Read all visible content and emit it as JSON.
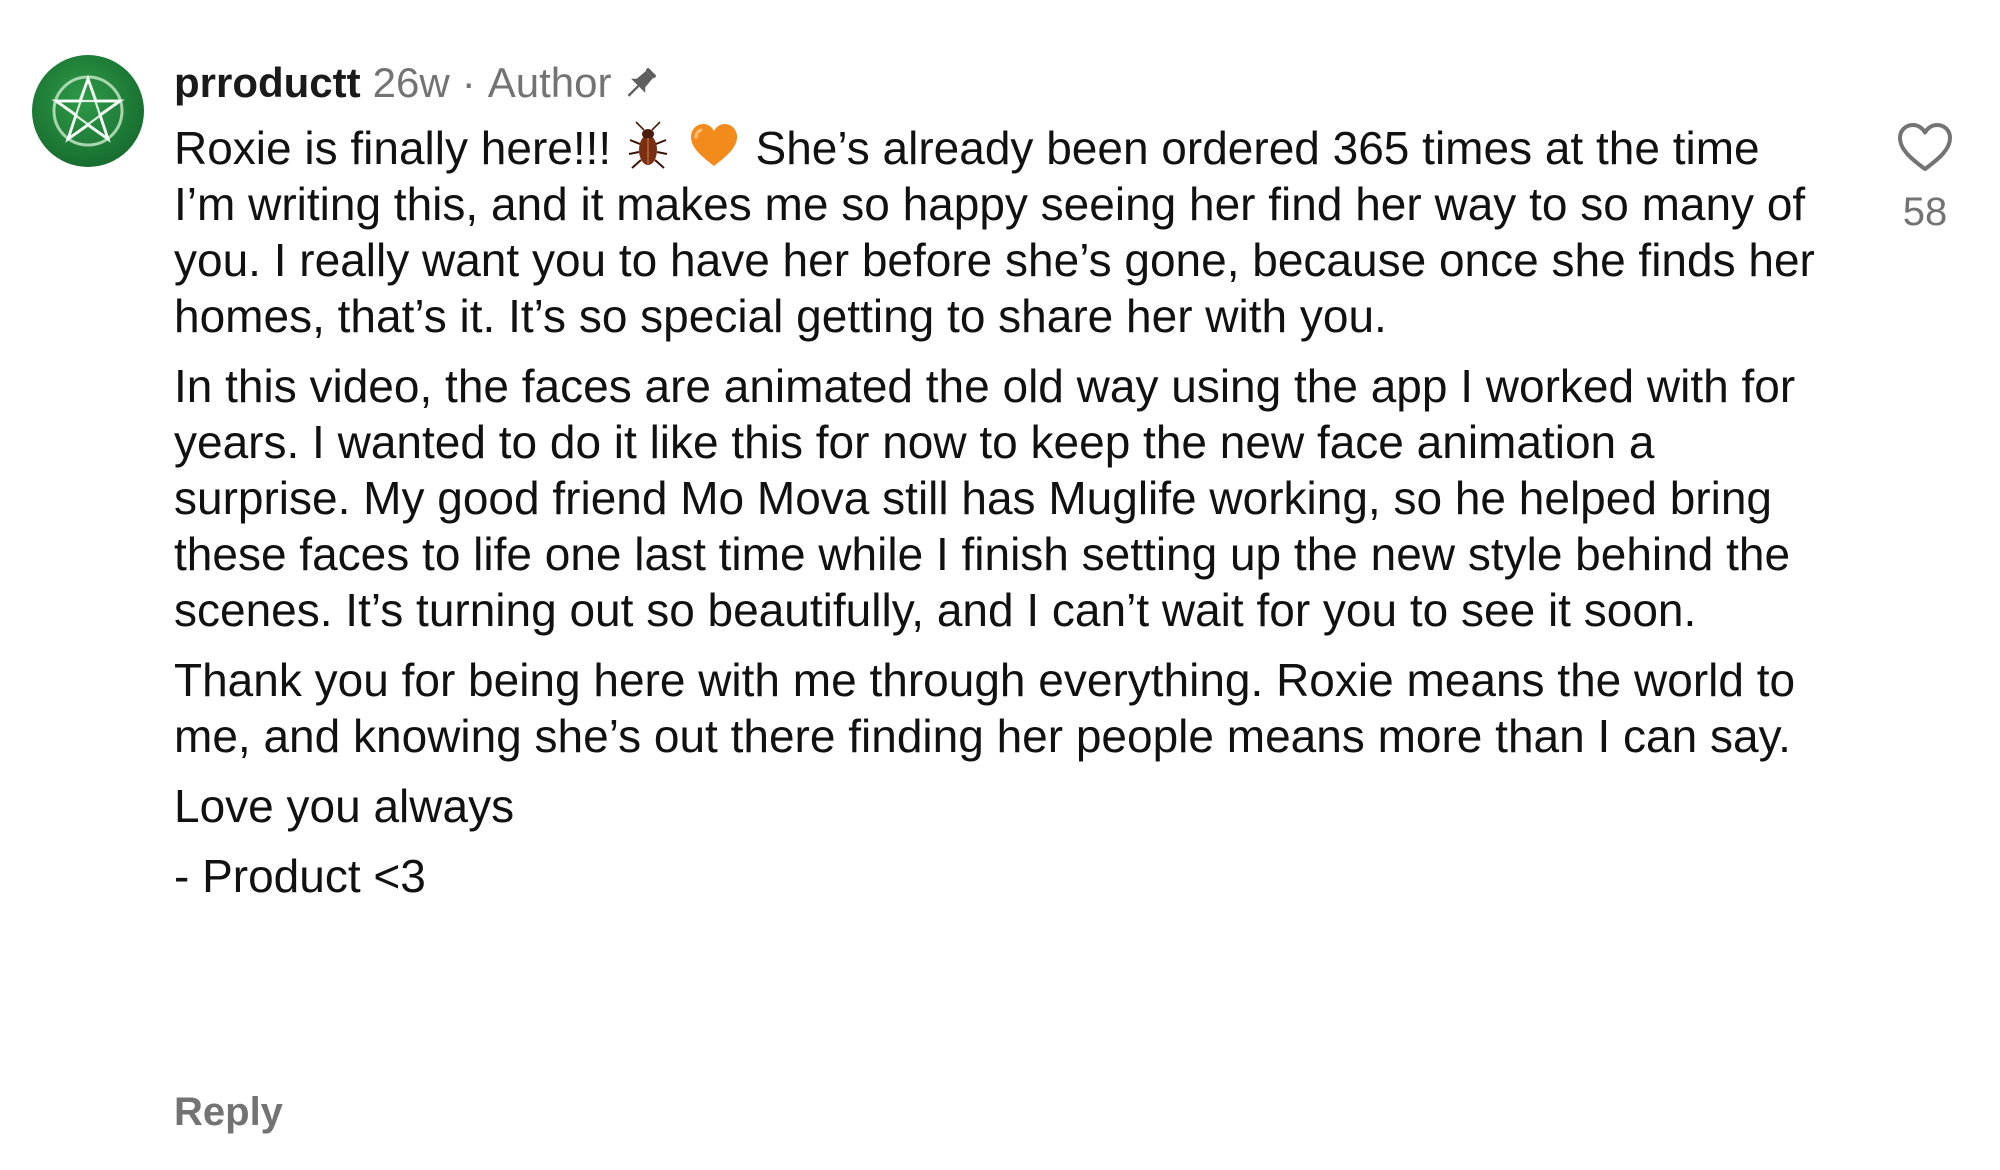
{
  "comment": {
    "username": "prroductt",
    "age": "26w",
    "separator": "·",
    "author_label": "Author",
    "paragraph1_part1": "Roxie is finally here!!!",
    "paragraph1_part2": "She’s already been ordered 365 times at the time I’m writing this, and it makes me so happy seeing her find her way to so many of you. I really want you to have her before she’s gone, because once she finds her homes, that’s it. It’s so special getting to share her with you.",
    "paragraph2": "In this video, the faces are animated the old way using the app I worked with for years. I wanted to do it like this for now to keep the new face animation a surprise. My good friend Mo Mova still has Muglife working, so he helped bring these faces to life one last time while I finish setting up the new style behind the scenes. It’s turning out so beautifully, and I can’t wait for you to see it soon.",
    "paragraph3": "Thank you for being here with me through everything. Roxie means the world to me, and knowing she’s out there finding her people means more than I can say.",
    "paragraph4": "Love you always",
    "paragraph5": "- Product <3",
    "reply_label": "Reply",
    "like_count": "58"
  },
  "icons": {
    "avatar": "green-pentagram-avatar",
    "pin": "pin-icon",
    "emoji1": "cockroach-icon",
    "emoji2": "orange-heart-icon",
    "like": "heart-outline-icon"
  },
  "colors": {
    "text": "#111111",
    "secondary": "#737373",
    "avatar_green": "#1d7a36",
    "orange_heart": "#f28a1c"
  }
}
